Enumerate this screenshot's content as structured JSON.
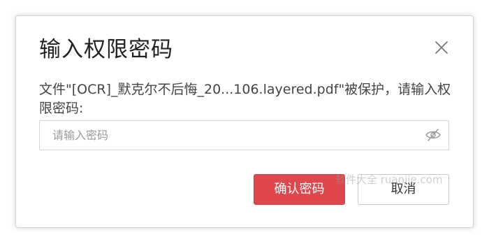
{
  "dialog": {
    "title": "输入权限密码",
    "message": "文件\"[OCR]_默克尔不后悔_20...106.layered.pdf\"被保护，请输入权限密码:",
    "password_placeholder": "请输入密码",
    "password_value": "",
    "confirm_label": "确认密码",
    "cancel_label": "取消"
  },
  "icons": {
    "close": "close-icon",
    "eye": "eye-off-icon"
  },
  "watermark": "软件大全 ruanjie.com",
  "colors": {
    "accent": "#e0474d",
    "title_text": "#222222",
    "body_text": "#444444",
    "placeholder_text": "#9a9a9a",
    "border": "#d6d6d6"
  }
}
